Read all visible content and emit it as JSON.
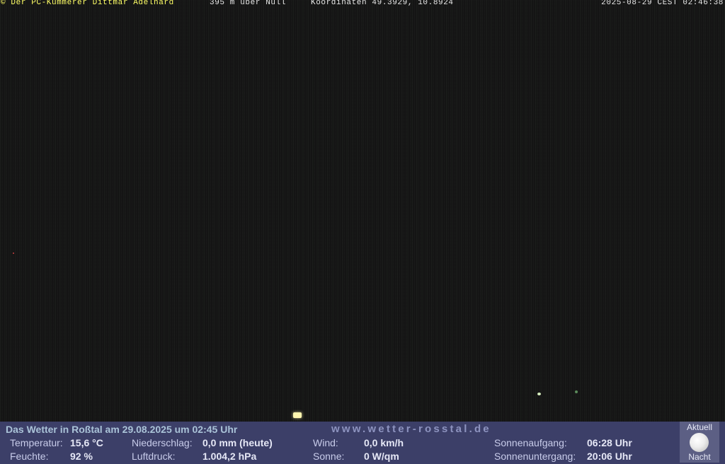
{
  "overlay": {
    "copyright": "© Der PC-Kümmerer Dittmar Adelhard",
    "altitude": "395 m über Null",
    "coordinates": "Koordinaten 49.3929, 10.8924",
    "timestamp": "2025-08-29 CEST 02:46:38"
  },
  "weather": {
    "title": "Das Wetter in Roßtal am 29.08.2025 um 02:45 Uhr",
    "website": "www.wetter-rosstal.de",
    "temperature_label": "Temperatur:",
    "temperature_value": "15,6 °C",
    "humidity_label": "Feuchte:",
    "humidity_value": "92 %",
    "precip_label": "Niederschlag:",
    "precip_value": "0,0 mm (heute)",
    "pressure_label": "Luftdruck:",
    "pressure_value": "1.004,2 hPa",
    "wind_label": "Wind:",
    "wind_value": "0,0 km/h",
    "sun_label": "Sonne:",
    "sun_value": "0 W/qm",
    "sunrise_label": "Sonnenaufgang:",
    "sunrise_value": "06:28 Uhr",
    "sunset_label": "Sonnenuntergang:",
    "sunset_value": "20:06 Uhr",
    "moon_top": "Aktuell",
    "moon_bottom": "Nacht"
  },
  "icons": [
    "moon-icon"
  ]
}
